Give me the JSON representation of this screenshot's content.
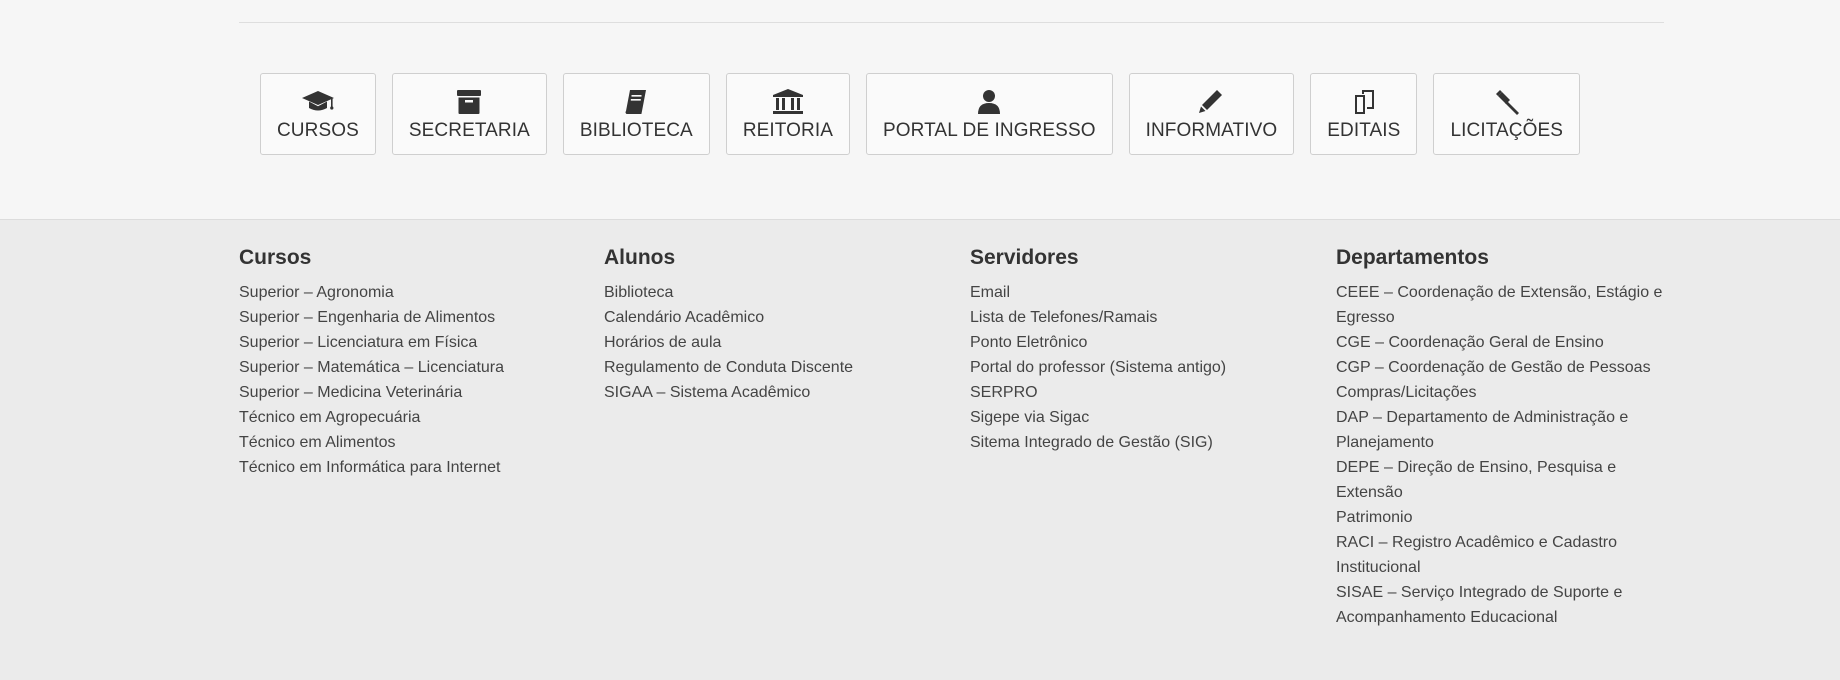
{
  "shortcuts": [
    {
      "label": "CURSOS",
      "icon": "graduation-cap-icon"
    },
    {
      "label": "SECRETARIA",
      "icon": "archive-box-icon"
    },
    {
      "label": "BIBLIOTECA",
      "icon": "book-icon"
    },
    {
      "label": "REITORIA",
      "icon": "institution-icon"
    },
    {
      "label": "PORTAL DE INGRESSO",
      "icon": "user-icon"
    },
    {
      "label": "INFORMATIVO",
      "icon": "pencil-icon"
    },
    {
      "label": "EDITAIS",
      "icon": "copy-documents-icon"
    },
    {
      "label": "LICITAÇÕES",
      "icon": "gavel-icon"
    }
  ],
  "footer": {
    "cursos": {
      "title": "Cursos",
      "items": [
        "Superior – Agronomia",
        "Superior – Engenharia de Alimentos",
        "Superior – Licenciatura em Física",
        "Superior – Matemática – Licenciatura",
        "Superior – Medicina Veterinária",
        "Técnico em Agropecuária",
        "Técnico em Alimentos",
        "Técnico em Informática para Internet"
      ]
    },
    "alunos": {
      "title": "Alunos",
      "items": [
        "Biblioteca",
        "Calendário Acadêmico",
        "Horários de aula",
        "Regulamento de Conduta Discente",
        "SIGAA – Sistema Acadêmico"
      ]
    },
    "servidores": {
      "title": "Servidores",
      "items": [
        "Email",
        "Lista de Telefones/Ramais",
        "Ponto Eletrônico",
        "Portal do professor (Sistema antigo)",
        "SERPRO",
        "Sigepe via Sigac",
        "Sitema Integrado de Gestão (SIG)"
      ]
    },
    "departamentos": {
      "title": "Departamentos",
      "items": [
        "CEEE – Coordenação de Extensão, Estágio e Egresso",
        "CGE – Coordenação Geral de Ensino",
        "CGP – Coordenação de Gestão de Pessoas",
        "Compras/Licitações",
        "DAP – Departamento de Administração e Planejamento",
        "DEPE – Direção de Ensino, Pesquisa e Extensão",
        "Patrimonio",
        "RACI – Registro Acadêmico e Cadastro Institucional",
        "SISAE – Serviço Integrado de Suporte e Acompanhamento Educacional"
      ]
    }
  }
}
